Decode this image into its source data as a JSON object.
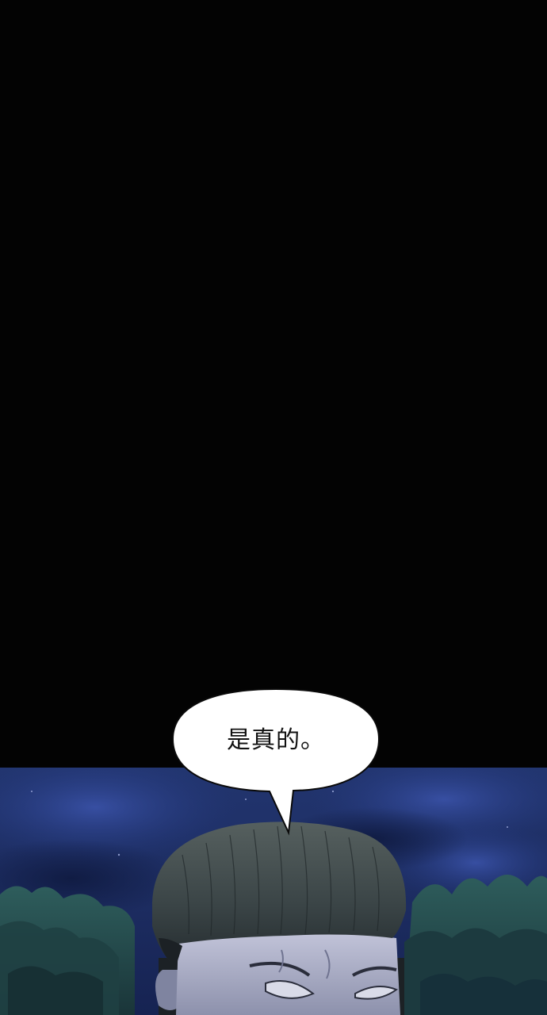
{
  "dialogue": {
    "line": "是真的。"
  },
  "colors": {
    "background": "#030303",
    "sky": "#1c2f6e",
    "bubble_fill": "#ffffff",
    "hair": "#3b4548",
    "skin": "#aeb2c9"
  }
}
